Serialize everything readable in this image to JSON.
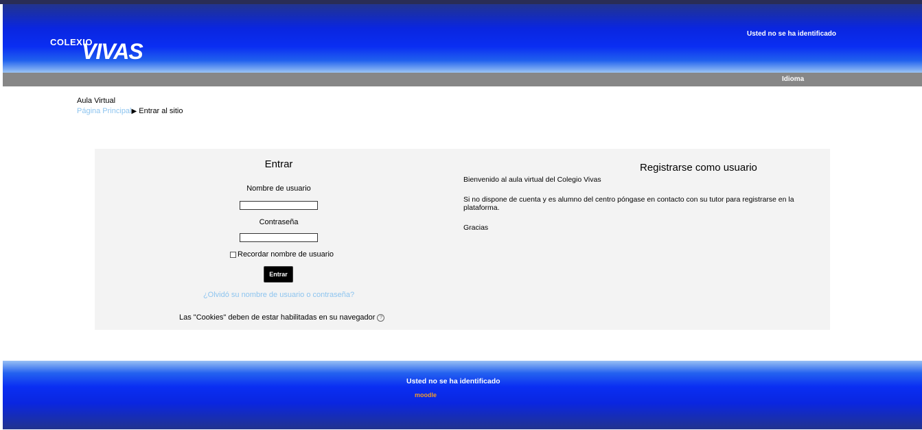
{
  "header": {
    "logo_small": "COLEXIO",
    "logo_big": "VIVAS",
    "login_info": "Usted no se ha identificado"
  },
  "navbar": {
    "language": "Idioma"
  },
  "breadcrumb": {
    "site": "Aula Virtual",
    "home": "Página Principal",
    "separator": "▶",
    "current": "Entrar al sitio"
  },
  "login": {
    "title": "Entrar",
    "username_label": "Nombre de usuario",
    "username_value": "",
    "password_label": "Contraseña",
    "password_value": "",
    "remember_label": "Recordar nombre de usuario",
    "remember_checked": false,
    "submit_label": "Entrar",
    "forgot_link": "¿Olvidó su nombre de usuario o contraseña?",
    "cookies_note": "Las \"Cookies\" deben de estar habilitadas en su navegador",
    "help_icon": "help-icon"
  },
  "register": {
    "title": "Registrarse como usuario",
    "welcome": "Bienvenido al aula virtual del Colegio Vivas",
    "info": "Si no dispone de cuenta y es alumno del centro póngase en contacto con su tutor para registrarse en la plataforma.",
    "thanks": "Gracias"
  },
  "footer": {
    "login_info": "Usted no se ha identificado",
    "moodle": "moodle"
  },
  "colors": {
    "header_blue": "#0a2ef2",
    "navbar_gray": "#878787",
    "link_blue": "#8dc4ef",
    "panel_bg": "#f3f3f3",
    "moodle_orange": "#f09a2a"
  }
}
